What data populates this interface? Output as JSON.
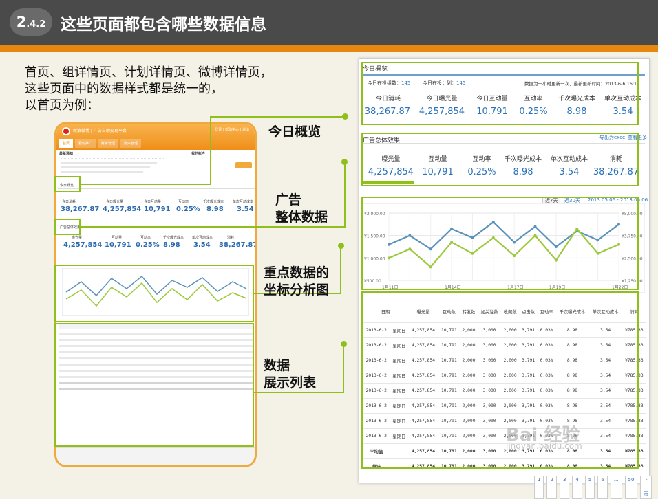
{
  "slide": {
    "number": "2",
    "sub": ".4.2",
    "title": "这些页面都包含哪些数据信息"
  },
  "intro": [
    "首页、组详情页、计划详情页、微博详情页，",
    "这些页面中的数据样式都是统一的，",
    "以首页为例："
  ],
  "callouts": {
    "c1": "今日概览",
    "c2a": "广告",
    "c2b": "整体数据",
    "c3a": "重点数据的",
    "c3b": "坐标分析图",
    "c4a": "数据",
    "c4b": "展示列表"
  },
  "thumb": {
    "brand": "新浪微博 | 广告自助交易平台",
    "links": "登录 | 帮助中心 | 退出",
    "tabs": [
      "首页",
      "我的推广",
      "财务管理",
      "账户管理"
    ],
    "notice": "最新通知",
    "account": "我的帐户",
    "today": "今日概览",
    "ad": "广告总体效果",
    "summary": [
      {
        "l": "今日消耗",
        "v": "38,267.87"
      },
      {
        "l": "今日曝光量",
        "v": "4,257,854"
      },
      {
        "l": "今日互动量",
        "v": "10,791"
      },
      {
        "l": "互动率",
        "v": "0.25%"
      },
      {
        "l": "千次曝光成本",
        "v": "8.98"
      },
      {
        "l": "单次互动成本",
        "v": "3.54"
      }
    ],
    "overall": [
      {
        "l": "曝光量",
        "v": "4,257,854"
      },
      {
        "l": "互动量",
        "v": "10,791"
      },
      {
        "l": "互动率",
        "v": "0.25%"
      },
      {
        "l": "千次曝光成本",
        "v": "8.98"
      },
      {
        "l": "单次互动成本",
        "v": "3.54"
      },
      {
        "l": "消耗",
        "v": "38,267.87"
      }
    ]
  },
  "shot": {
    "today": "今日概览",
    "groups_label": "今日在投组数：",
    "groups": "145",
    "plans_label": "今日在投计划：",
    "plans": "145",
    "update": "数据为一小时更新一次，最新更新时间：2013-6-6 16:12",
    "summary": [
      {
        "l": "今日消耗",
        "v": "38,267.87"
      },
      {
        "l": "今日曝光量",
        "v": "4,257,854"
      },
      {
        "l": "今日互动量",
        "v": "10,791"
      },
      {
        "l": "互动率",
        "v": "0.25%"
      },
      {
        "l": "千次曝光成本",
        "v": "8.98"
      },
      {
        "l": "单次互动成本",
        "v": "3.54"
      }
    ],
    "ad": "广告总体效果",
    "export": "导出为excel",
    "more": "查看更多",
    "overall": [
      {
        "l": "曝光量",
        "v": "4,257,854"
      },
      {
        "l": "互动量",
        "v": "10,791"
      },
      {
        "l": "互动率",
        "v": "0.25%"
      },
      {
        "l": "千次曝光成本",
        "v": "8.98"
      },
      {
        "l": "单次互动成本",
        "v": "3.54"
      },
      {
        "l": "消耗",
        "v": "38,267.87"
      }
    ],
    "range_btn1": "近7天",
    "range_btn2": "近30天",
    "range": "2013.05.06 - 2013.06.06",
    "yleft": [
      "¥2,000.00",
      "¥1,500.00",
      "¥1,000.00",
      "¥500.00"
    ],
    "yright": [
      "¥5,000.00",
      "¥3,750.00",
      "¥2,500.00",
      "¥1,250.00"
    ],
    "xlabels": [
      "1月11日",
      "1月14日",
      "1月17日",
      "1月19日",
      "1月22日"
    ],
    "headers": [
      "日期",
      "曝光量",
      "互动数",
      "转发数",
      "加关注数",
      "收藏数",
      "点击数",
      "互动率",
      "千次曝光成本",
      "单次互动成本",
      "消耗"
    ],
    "rows": [
      [
        "2013-6-2",
        "星期日",
        "4,257,854",
        "10,791",
        "2,000",
        "3,000",
        "2,000",
        "3,791",
        "0.03%",
        "8.98",
        "3.54",
        "¥785.33"
      ],
      [
        "2013-6-2",
        "星期日",
        "4,257,854",
        "10,791",
        "2,000",
        "3,000",
        "2,000",
        "3,791",
        "0.03%",
        "8.98",
        "3.54",
        "¥785.33"
      ],
      [
        "2013-6-2",
        "星期日",
        "4,257,854",
        "10,791",
        "2,000",
        "3,000",
        "2,000",
        "3,791",
        "0.03%",
        "8.98",
        "3.54",
        "¥785.33"
      ],
      [
        "2013-6-2",
        "星期日",
        "4,257,854",
        "10,791",
        "2,000",
        "3,000",
        "2,000",
        "3,791",
        "0.03%",
        "8.98",
        "3.54",
        "¥785.33"
      ],
      [
        "2013-6-2",
        "星期日",
        "4,257,854",
        "10,791",
        "2,000",
        "3,000",
        "2,000",
        "3,791",
        "0.03%",
        "8.98",
        "3.54",
        "¥785.33"
      ],
      [
        "2013-6-2",
        "星期日",
        "4,257,854",
        "10,791",
        "2,000",
        "3,000",
        "2,000",
        "3,791",
        "0.03%",
        "8.98",
        "3.54",
        "¥785.33"
      ],
      [
        "2013-6-2",
        "星期日",
        "4,257,854",
        "10,791",
        "2,000",
        "3,000",
        "2,000",
        "3,791",
        "0.03%",
        "8.98",
        "3.54",
        "¥785.33"
      ],
      [
        "2013-6-2",
        "星期日",
        "4,257,854",
        "10,791",
        "2,000",
        "3,000",
        "2,000",
        "3,791",
        "0.03%",
        "8.98",
        "3.54",
        "¥785.33"
      ]
    ],
    "avg": [
      "平均值",
      "",
      "4,257,854",
      "10,791",
      "2,000",
      "3,000",
      "2,000",
      "3,791",
      "0.03%",
      "8.98",
      "3.54",
      "¥785.33"
    ],
    "total": [
      "总计",
      "",
      "4,257,854",
      "10,791",
      "2,000",
      "3,000",
      "2,000",
      "3,791",
      "0.03%",
      "8.98",
      "3.54",
      "¥785.33"
    ],
    "pages": [
      "1",
      "2",
      "3",
      "4",
      "5",
      "6",
      "...",
      "50",
      "下一页"
    ]
  },
  "watermark": "Bai 经验",
  "watermark_url": "jingyan.baidu.com",
  "colors": {
    "accent": "#8fbf1a",
    "orange": "#e8870f",
    "blue": "#2a72b8"
  },
  "chart_data": {
    "type": "line",
    "x": [
      "1月11日",
      "",
      "",
      "1月14日",
      "",
      "",
      "1月17日",
      "",
      "1月19日",
      "",
      "",
      "1月22日"
    ],
    "series": [
      {
        "values": [
          1300,
          1500,
          1200,
          1650,
          1450,
          1800,
          1350,
          1700,
          1250,
          1600,
          1400,
          1750
        ]
      },
      {
        "values": [
          1000,
          1200,
          800,
          1350,
          1100,
          1450,
          1050,
          1500,
          950,
          1650,
          1100,
          1300
        ]
      }
    ],
    "ylim": [
      500,
      2000
    ]
  }
}
